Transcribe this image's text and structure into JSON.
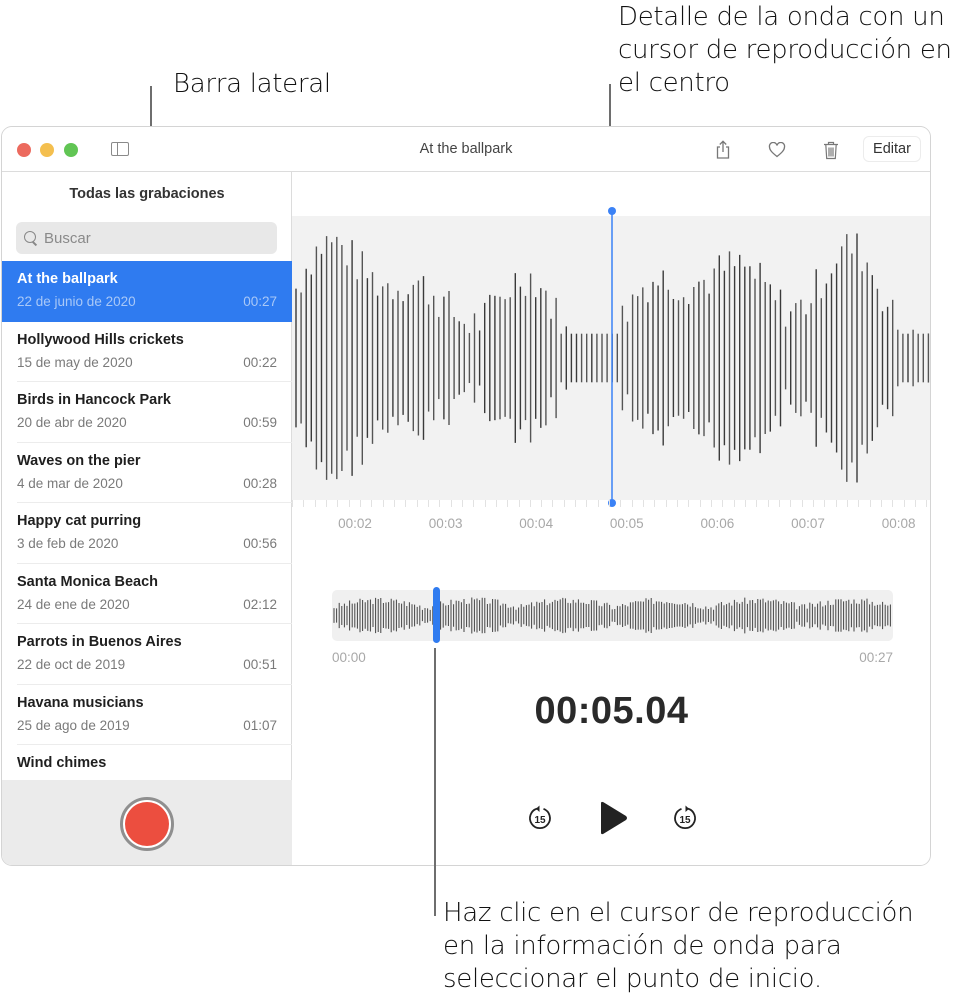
{
  "callouts": {
    "sidebar": "Barra lateral",
    "detail_line1": "Detalle de la onda con un",
    "detail_line2": "cursor de reproducción en",
    "detail_line3": "el centro",
    "playhead_line1": "Haz clic en el cursor de reproducción",
    "playhead_line2": "en la información de onda para",
    "playhead_line3": "seleccionar el punto de inicio."
  },
  "window": {
    "title": "At the ballpark",
    "toolbar": {
      "share_icon": "share-icon",
      "favorite_icon": "heart-icon",
      "delete_icon": "trash-icon",
      "edit_label": "Editar"
    }
  },
  "sidebar": {
    "header": "Todas las grabaciones",
    "search_placeholder": "Buscar",
    "items": [
      {
        "title": "At the ballpark",
        "date": "22 de junio de 2020",
        "duration": "00:27",
        "selected": true
      },
      {
        "title": "Hollywood Hills crickets",
        "date": "15 de may de 2020",
        "duration": "00:22"
      },
      {
        "title": "Birds in Hancock Park",
        "date": "20 de abr de 2020",
        "duration": "00:59"
      },
      {
        "title": "Waves on the pier",
        "date": "4 de mar de 2020",
        "duration": "00:28"
      },
      {
        "title": "Happy cat purring",
        "date": "3 de feb de 2020",
        "duration": "00:56"
      },
      {
        "title": "Santa Monica Beach",
        "date": "24 de ene de 2020",
        "duration": "02:12"
      },
      {
        "title": "Parrots in Buenos Aires",
        "date": "22 de oct de 2019",
        "duration": "00:51"
      },
      {
        "title": "Havana musicians",
        "date": "25 de ago de 2019",
        "duration": "01:07"
      },
      {
        "title": "Wind chimes",
        "date": "",
        "duration": ""
      }
    ]
  },
  "player": {
    "ruler_labels": [
      "00:02",
      "00:03",
      "00:04",
      "00:05",
      "00:06",
      "00:07",
      "00:08"
    ],
    "overview_start": "00:00",
    "overview_end": "00:27",
    "current_time": "00:05.04",
    "playhead_fraction": 0.187,
    "skip_back_label": "15",
    "skip_forward_label": "15"
  },
  "colors": {
    "accent": "#2f7bf0",
    "record": "#ec4e3f",
    "playhead": "#3b82f6"
  }
}
